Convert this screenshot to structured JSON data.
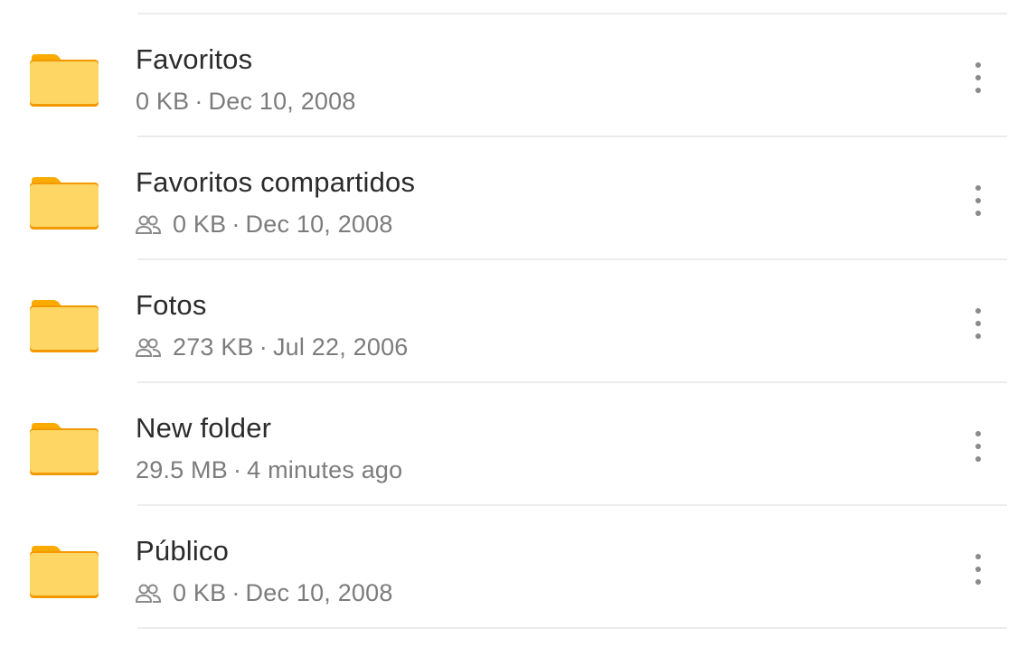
{
  "files": [
    {
      "name": "Favoritos",
      "shared": false,
      "size": "0 KB",
      "separator": "·",
      "date": "Dec 10, 2008"
    },
    {
      "name": "Favoritos compartidos",
      "shared": true,
      "size": "0 KB",
      "separator": "·",
      "date": "Dec 10, 2008"
    },
    {
      "name": "Fotos",
      "shared": true,
      "size": "273 KB",
      "separator": "·",
      "date": "Jul 22, 2006"
    },
    {
      "name": "New folder",
      "shared": false,
      "size": "29.5 MB",
      "separator": "·",
      "date": "4 minutes ago"
    },
    {
      "name": "Público",
      "shared": true,
      "size": "0 KB",
      "separator": "·",
      "date": "Dec 10, 2008"
    }
  ],
  "icons": {
    "folder": "folder-icon",
    "shared": "shared-people-icon",
    "more": "more-vert-icon"
  },
  "colors": {
    "folder_body": "#fdd663",
    "folder_tab": "#f9ab00",
    "folder_base": "#f29900"
  }
}
